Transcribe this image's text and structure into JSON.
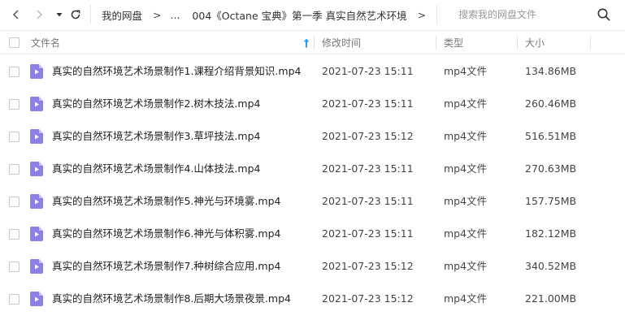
{
  "nav": {
    "back_icon": "chevron-left-icon",
    "forward_icon": "chevron-right-icon",
    "history_icon": "caret-down-icon",
    "refresh_icon": "refresh-icon"
  },
  "breadcrumb": {
    "root": "我的网盘",
    "sep1": ">",
    "ellipsis": "...",
    "current": "004《Octane 宝典》第一季 真实自然艺术环境",
    "sep2": ">",
    "sep3": ">"
  },
  "search": {
    "placeholder": "搜索我的网盘文件",
    "icon": "search-icon"
  },
  "columns": {
    "name": "文件名",
    "modified": "修改时间",
    "type": "类型",
    "size": "大小",
    "sort_icon": "arrow-up-icon",
    "sort_color": "#2a9df4"
  },
  "colors": {
    "video_icon": "#8b80e8",
    "video_icon_fold": "#c7c1f5"
  },
  "files": [
    {
      "name": "真实的自然环境艺术场景制作1.课程介绍背景知识.mp4",
      "time": "2021-07-23 15:11",
      "type": "mp4文件",
      "size": "134.86MB"
    },
    {
      "name": "真实的自然环境艺术场景制作2.树木技法.mp4",
      "time": "2021-07-23 15:11",
      "type": "mp4文件",
      "size": "260.46MB"
    },
    {
      "name": "真实的自然环境艺术场景制作3.草坪技法.mp4",
      "time": "2021-07-23 15:12",
      "type": "mp4文件",
      "size": "516.51MB"
    },
    {
      "name": "真实的自然环境艺术场景制作4.山体技法.mp4",
      "time": "2021-07-23 15:11",
      "type": "mp4文件",
      "size": "270.63MB"
    },
    {
      "name": "真实的自然环境艺术场景制作5.神光与环境雾.mp4",
      "time": "2021-07-23 15:11",
      "type": "mp4文件",
      "size": "157.75MB"
    },
    {
      "name": "真实的自然环境艺术场景制作6.神光与体积雾.mp4",
      "time": "2021-07-23 15:11",
      "type": "mp4文件",
      "size": "182.12MB"
    },
    {
      "name": "真实的自然环境艺术场景制作7.种树综合应用.mp4",
      "time": "2021-07-23 15:12",
      "type": "mp4文件",
      "size": "340.52MB"
    },
    {
      "name": "真实的自然环境艺术场景制作8.后期大场景夜景.mp4",
      "time": "2021-07-23 15:12",
      "type": "mp4文件",
      "size": "221.00MB"
    }
  ]
}
